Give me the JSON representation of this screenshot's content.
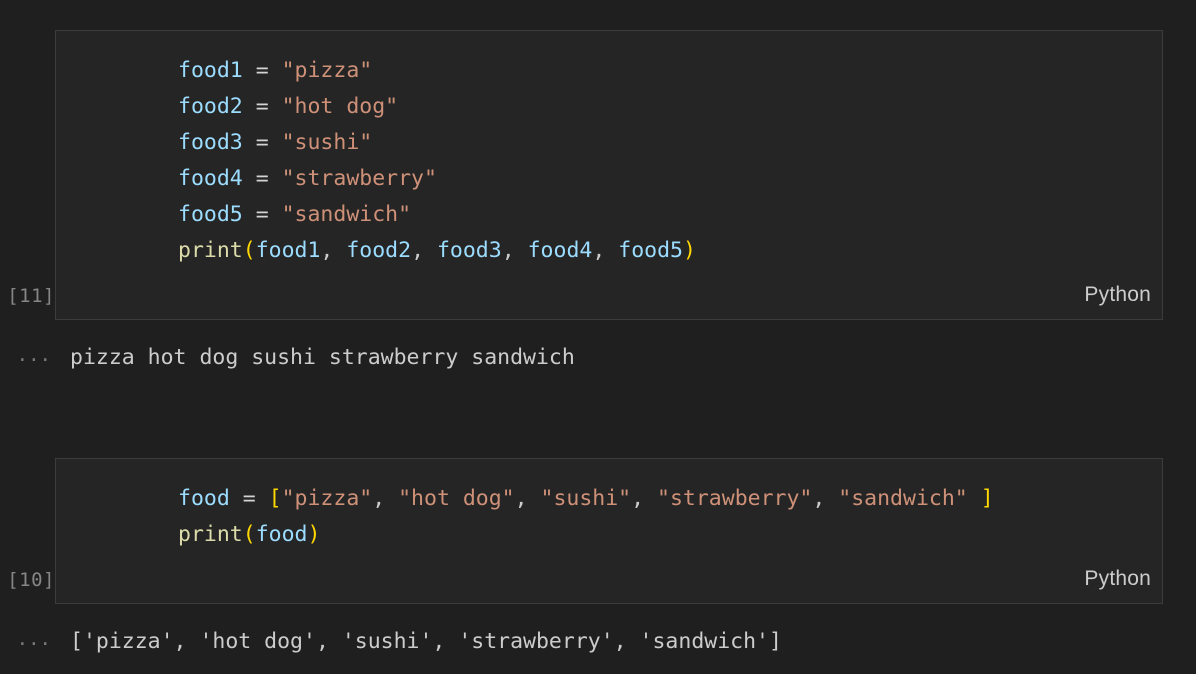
{
  "app": {
    "theme": "dark",
    "colors": {
      "background": "#1f1f1f",
      "cell_background": "#252526",
      "cell_border": "#3c3c3c",
      "variable": "#9cdcfe",
      "string": "#ce9178",
      "function": "#dcdcaa",
      "bracket": "#ffd700",
      "operator": "#d4d4d4",
      "output_text": "#cccccc",
      "gutter_text": "#868686"
    }
  },
  "cells": [
    {
      "execution_label": "[11]",
      "language": "Python",
      "lines": [
        [
          {
            "t": "food1",
            "c": "var"
          },
          {
            "t": " ",
            "c": "op"
          },
          {
            "t": "=",
            "c": "op"
          },
          {
            "t": " ",
            "c": "op"
          },
          {
            "t": "\"pizza\"",
            "c": "str"
          }
        ],
        [
          {
            "t": "food2",
            "c": "var"
          },
          {
            "t": " ",
            "c": "op"
          },
          {
            "t": "=",
            "c": "op"
          },
          {
            "t": " ",
            "c": "op"
          },
          {
            "t": "\"hot dog\"",
            "c": "str"
          }
        ],
        [
          {
            "t": "food3",
            "c": "var"
          },
          {
            "t": " ",
            "c": "op"
          },
          {
            "t": "=",
            "c": "op"
          },
          {
            "t": " ",
            "c": "op"
          },
          {
            "t": "\"sushi\"",
            "c": "str"
          }
        ],
        [
          {
            "t": "food4",
            "c": "var"
          },
          {
            "t": " ",
            "c": "op"
          },
          {
            "t": "=",
            "c": "op"
          },
          {
            "t": " ",
            "c": "op"
          },
          {
            "t": "\"strawberry\"",
            "c": "str"
          }
        ],
        [
          {
            "t": "food5",
            "c": "var"
          },
          {
            "t": " ",
            "c": "op"
          },
          {
            "t": "=",
            "c": "op"
          },
          {
            "t": " ",
            "c": "op"
          },
          {
            "t": "\"sandwich\"",
            "c": "str"
          }
        ],
        [
          {
            "t": "print",
            "c": "fn"
          },
          {
            "t": "(",
            "c": "paren"
          },
          {
            "t": "food1",
            "c": "var"
          },
          {
            "t": ",",
            "c": "punct"
          },
          {
            "t": " ",
            "c": "op"
          },
          {
            "t": "food2",
            "c": "var"
          },
          {
            "t": ",",
            "c": "punct"
          },
          {
            "t": " ",
            "c": "op"
          },
          {
            "t": "food3",
            "c": "var"
          },
          {
            "t": ",",
            "c": "punct"
          },
          {
            "t": " ",
            "c": "op"
          },
          {
            "t": "food4",
            "c": "var"
          },
          {
            "t": ",",
            "c": "punct"
          },
          {
            "t": " ",
            "c": "op"
          },
          {
            "t": "food5",
            "c": "var"
          },
          {
            "t": ")",
            "c": "paren"
          }
        ]
      ],
      "output_prompt": "···",
      "output": "pizza hot dog sushi strawberry sandwich"
    },
    {
      "execution_label": "[10]",
      "language": "Python",
      "lines": [
        [
          {
            "t": "food",
            "c": "var"
          },
          {
            "t": " ",
            "c": "op"
          },
          {
            "t": "=",
            "c": "op"
          },
          {
            "t": " ",
            "c": "op"
          },
          {
            "t": "[",
            "c": "paren"
          },
          {
            "t": "\"pizza\"",
            "c": "str"
          },
          {
            "t": ",",
            "c": "punct"
          },
          {
            "t": " ",
            "c": "op"
          },
          {
            "t": "\"hot dog\"",
            "c": "str"
          },
          {
            "t": ",",
            "c": "punct"
          },
          {
            "t": " ",
            "c": "op"
          },
          {
            "t": "\"sushi\"",
            "c": "str"
          },
          {
            "t": ",",
            "c": "punct"
          },
          {
            "t": " ",
            "c": "op"
          },
          {
            "t": "\"strawberry\"",
            "c": "str"
          },
          {
            "t": ",",
            "c": "punct"
          },
          {
            "t": " ",
            "c": "op"
          },
          {
            "t": "\"sandwich\"",
            "c": "str"
          },
          {
            "t": " ",
            "c": "op"
          },
          {
            "t": "]",
            "c": "paren"
          }
        ],
        [
          {
            "t": "print",
            "c": "fn"
          },
          {
            "t": "(",
            "c": "paren"
          },
          {
            "t": "food",
            "c": "var"
          },
          {
            "t": ")",
            "c": "paren"
          }
        ]
      ],
      "output_prompt": "···",
      "output": "['pizza', 'hot dog', 'sushi', 'strawberry', 'sandwich']"
    }
  ]
}
